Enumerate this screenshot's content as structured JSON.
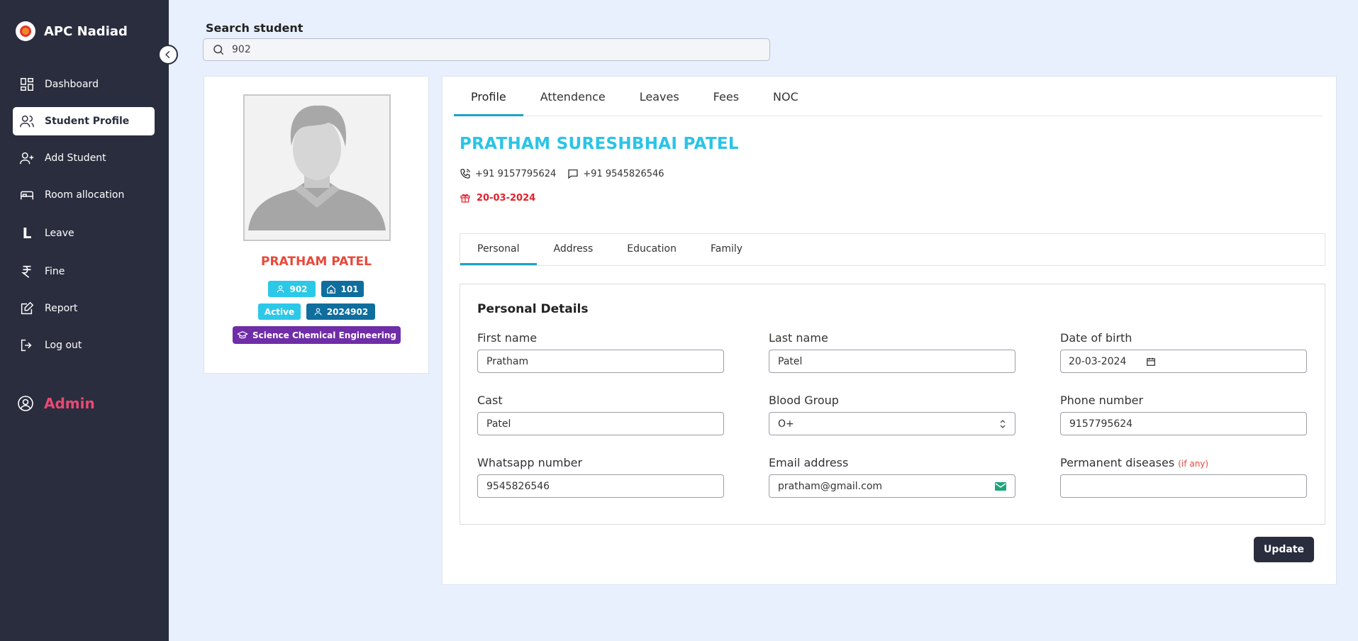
{
  "sidebar": {
    "brand": "APC Nadiad",
    "items": [
      {
        "label": "Dashboard",
        "icon": "dashboard-icon"
      },
      {
        "label": "Student Profile",
        "icon": "users-icon",
        "active": true
      },
      {
        "label": "Add Student",
        "icon": "user-plus-icon"
      },
      {
        "label": "Room allocation",
        "icon": "bed-icon"
      },
      {
        "label": "Leave",
        "icon": "letter-l-icon"
      },
      {
        "label": "Fine",
        "icon": "rupee-icon"
      },
      {
        "label": "Report",
        "icon": "report-edit-icon"
      },
      {
        "label": "Log out",
        "icon": "logout-icon"
      }
    ],
    "user": "Admin"
  },
  "search": {
    "label": "Search student",
    "value": "902"
  },
  "profile": {
    "name": "PRATHAM PATEL",
    "id_badge": "902",
    "room_badge": "101",
    "status": "Active",
    "enrollment": "2024902",
    "course": "Science Chemical Engineering"
  },
  "main": {
    "tabs": [
      "Profile",
      "Attendence",
      "Leaves",
      "Fees",
      "NOC"
    ],
    "full_name": "PRATHAM SURESHBHAI PATEL",
    "phone": "+91 9157795624",
    "whatsapp": "+91 9545826546",
    "dob": "20-03-2024",
    "subtabs": [
      "Personal",
      "Address",
      "Education",
      "Family"
    ],
    "details_title": "Personal Details",
    "fields": {
      "first_name": {
        "label": "First name",
        "value": "Pratham"
      },
      "last_name": {
        "label": "Last name",
        "value": "Patel"
      },
      "dob": {
        "label": "Date of birth",
        "value": "20-03-2024"
      },
      "cast": {
        "label": "Cast",
        "value": "Patel"
      },
      "blood_group": {
        "label": "Blood Group",
        "value": "O+"
      },
      "phone": {
        "label": "Phone number",
        "value": "9157795624"
      },
      "whatsapp": {
        "label": "Whatsapp number",
        "value": "9545826546"
      },
      "email": {
        "label": "Email address",
        "value": "pratham@gmail.com"
      },
      "diseases": {
        "label": "Permanent diseases",
        "hint": "(if any)",
        "value": ""
      }
    },
    "update_label": "Update"
  },
  "colors": {
    "sidebar_bg": "#2a2d3e",
    "accent_cyan": "#2ac4e6",
    "name_red": "#e8483a",
    "admin_pink": "#e84a72"
  }
}
